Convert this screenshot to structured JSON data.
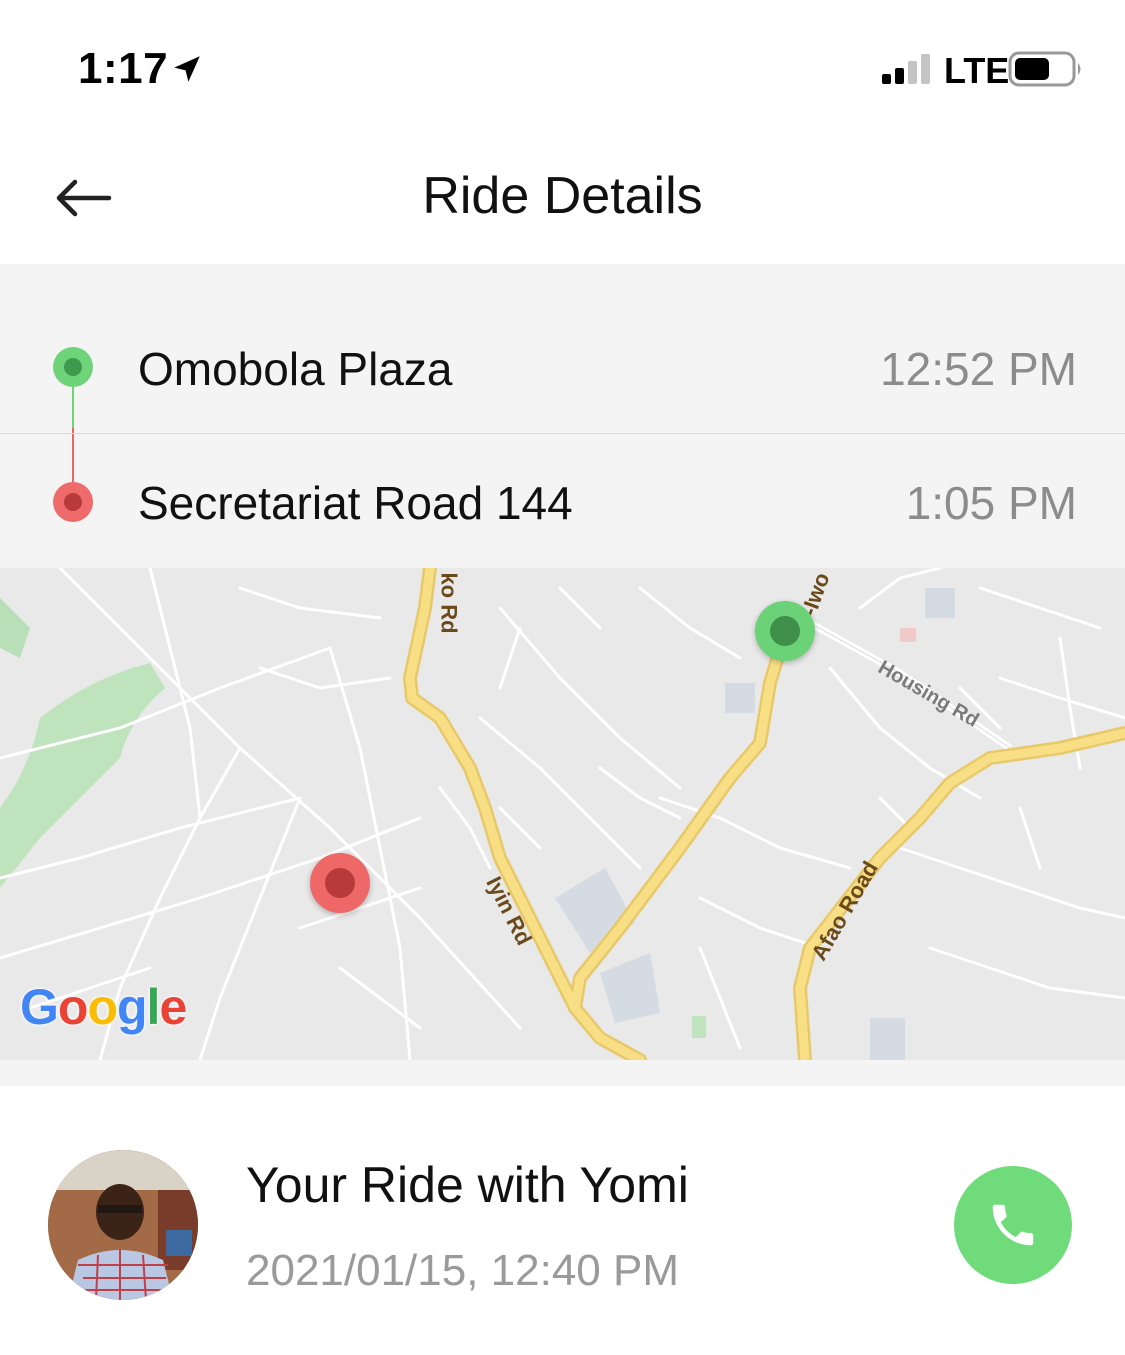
{
  "status_bar": {
    "time": "1:17",
    "network": "LTE"
  },
  "header": {
    "title": "Ride Details"
  },
  "route": {
    "pickup": {
      "name": "Omobola Plaza",
      "time": "12:52 PM"
    },
    "dropoff": {
      "name": "Secretariat Road 144",
      "time": "1:05 PM"
    }
  },
  "map": {
    "labels": {
      "road_top": "ko Rd",
      "iyin": "Iyin Rd",
      "housing": "Housing Rd",
      "afao": "Afao Road",
      "ado_iwo": "Ad  -Iwo"
    },
    "attribution": "Google"
  },
  "driver": {
    "title": "Your Ride with Yomi",
    "date": "2021/01/15, 12:40 PM"
  },
  "colors": {
    "pickup": "#6fd37a",
    "dropoff": "#ef6b6b",
    "call_button": "#6fdb7a",
    "road": "#f6d873"
  }
}
